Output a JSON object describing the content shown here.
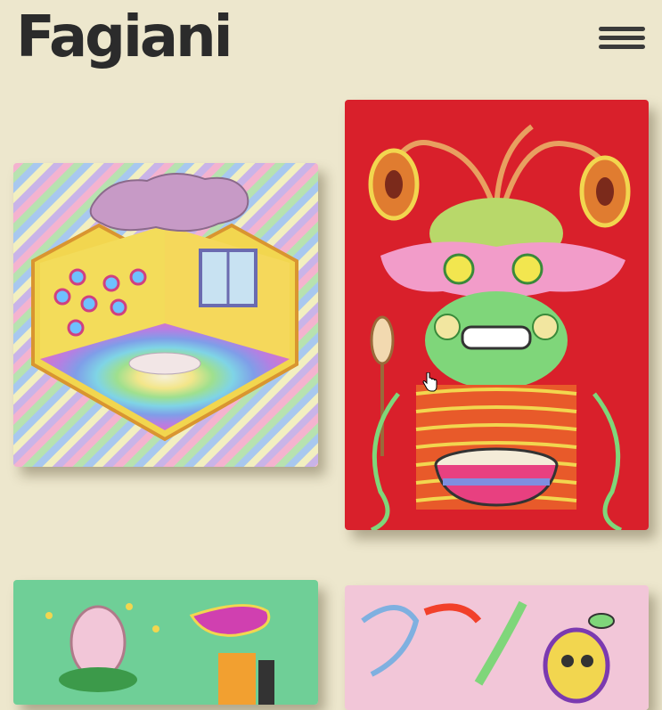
{
  "header": {
    "logo_text": "Fagiani",
    "menu_icon": "hamburger-menu-icon"
  },
  "colors": {
    "background": "#ede7cd",
    "logo": "#2b2b2b",
    "artwork_red": "#d9202b",
    "artwork_green": "#6fcf97",
    "artwork_pink": "#f2c6d8"
  },
  "gallery": {
    "items": [
      {
        "icon": "isometric-room-artwork"
      },
      {
        "icon": "green-creature-with-soup-artwork"
      },
      {
        "icon": "egg-and-guitar-artwork"
      },
      {
        "icon": "pink-creatures-artwork"
      }
    ]
  }
}
